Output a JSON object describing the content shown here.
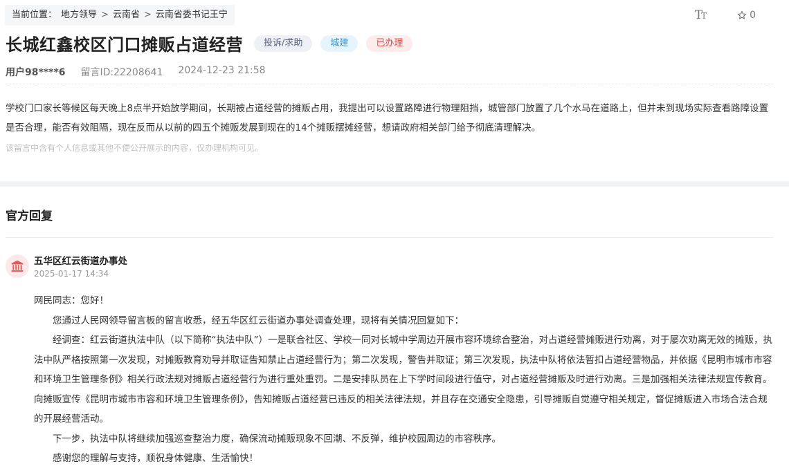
{
  "breadcrumb": {
    "prefix": "当前位置：",
    "items": [
      "地方领导",
      "云南省",
      "云南省委书记王宁"
    ],
    "separator": ">"
  },
  "toolbar": {
    "font_size_label": "TT",
    "like_count": "0"
  },
  "post": {
    "title": "长城红鑫校区门口摊贩占道经营",
    "tags": {
      "type": "投诉/求助",
      "area": "城建",
      "status": "已办理"
    },
    "user": "用户98****6",
    "message_id": "留言ID:22208641",
    "datetime": "2024-12-23 21:58",
    "content": "学校门口家长等候区每天晚上8点半开始放学期间，长期被占道经营的摊贩占用，我提出可以设置路障进行物理阻挡，城管部门放置了几个水马在道路上，但并未到现场实际查看路障设置是否合理，能否有效阻隔，现在反而从以前的四五个摊贩发展到现在的14个摊贩摆摊经营，想请政府相关部门给予彻底清理解决。",
    "privacy_note": "该留言中含有个人信息或其他不便公开展示的内容，仅办理机构可见。"
  },
  "reply_section": {
    "title": "官方回复",
    "org_name": "五华区红云街道办事处",
    "date": "2025-01-17 14:34",
    "greeting": "网民同志：您好！",
    "paragraphs": [
      "您通过人民网领导留言板的留言收悉，经五华区红云街道办事处调查处理，现将有关情况回复如下：",
      "经调查：红云街道执法中队（以下简称“执法中队”）一是联合社区、学校一同对长城中学周边开展市容环境综合整治，对占道经营摊贩进行劝离，对于屡次劝离无效的摊贩，执法中队严格按照第一次发现，对摊贩教育劝导并取证告知禁止占道经营行为；第二次发现，警告并取证；第三次发现，执法中队将依法暂扣占道经营物品，并依据《昆明市城市市容和环境卫生管理条例》相关行政法规对摊贩占道经营行为进行重处重罚。二是安排队员在上下学时间段进行值守，对占道经营摊贩及时进行劝离。三是加强相关法律法规宣传教育。向摊贩宣传《昆明市城市市容和环境卫生管理条例》，告知摊贩占道经营已违反的相关法律法规，并且存在交通安全隐患，引导摊贩自觉遵守相关规定，督促摊贩进入市场合法合规的开展经营活动。",
      "下一步，执法中队将继续加强巡查整治力度，确保流动摊贩现象不回潮、不反弹，维护校园周边的市容秩序。",
      "感谢您的理解与支持，顺祝身体健康、生活愉快！"
    ]
  },
  "colors": {
    "status_tag": "#e0484a",
    "area_tag": "#3d8fbf",
    "avatar_bg": "#fde9e9",
    "avatar_icon": "#e45a5a"
  },
  "icons": {
    "like": "star-icon",
    "avatar": "government-building-icon",
    "font_size": "font-size-icon"
  }
}
